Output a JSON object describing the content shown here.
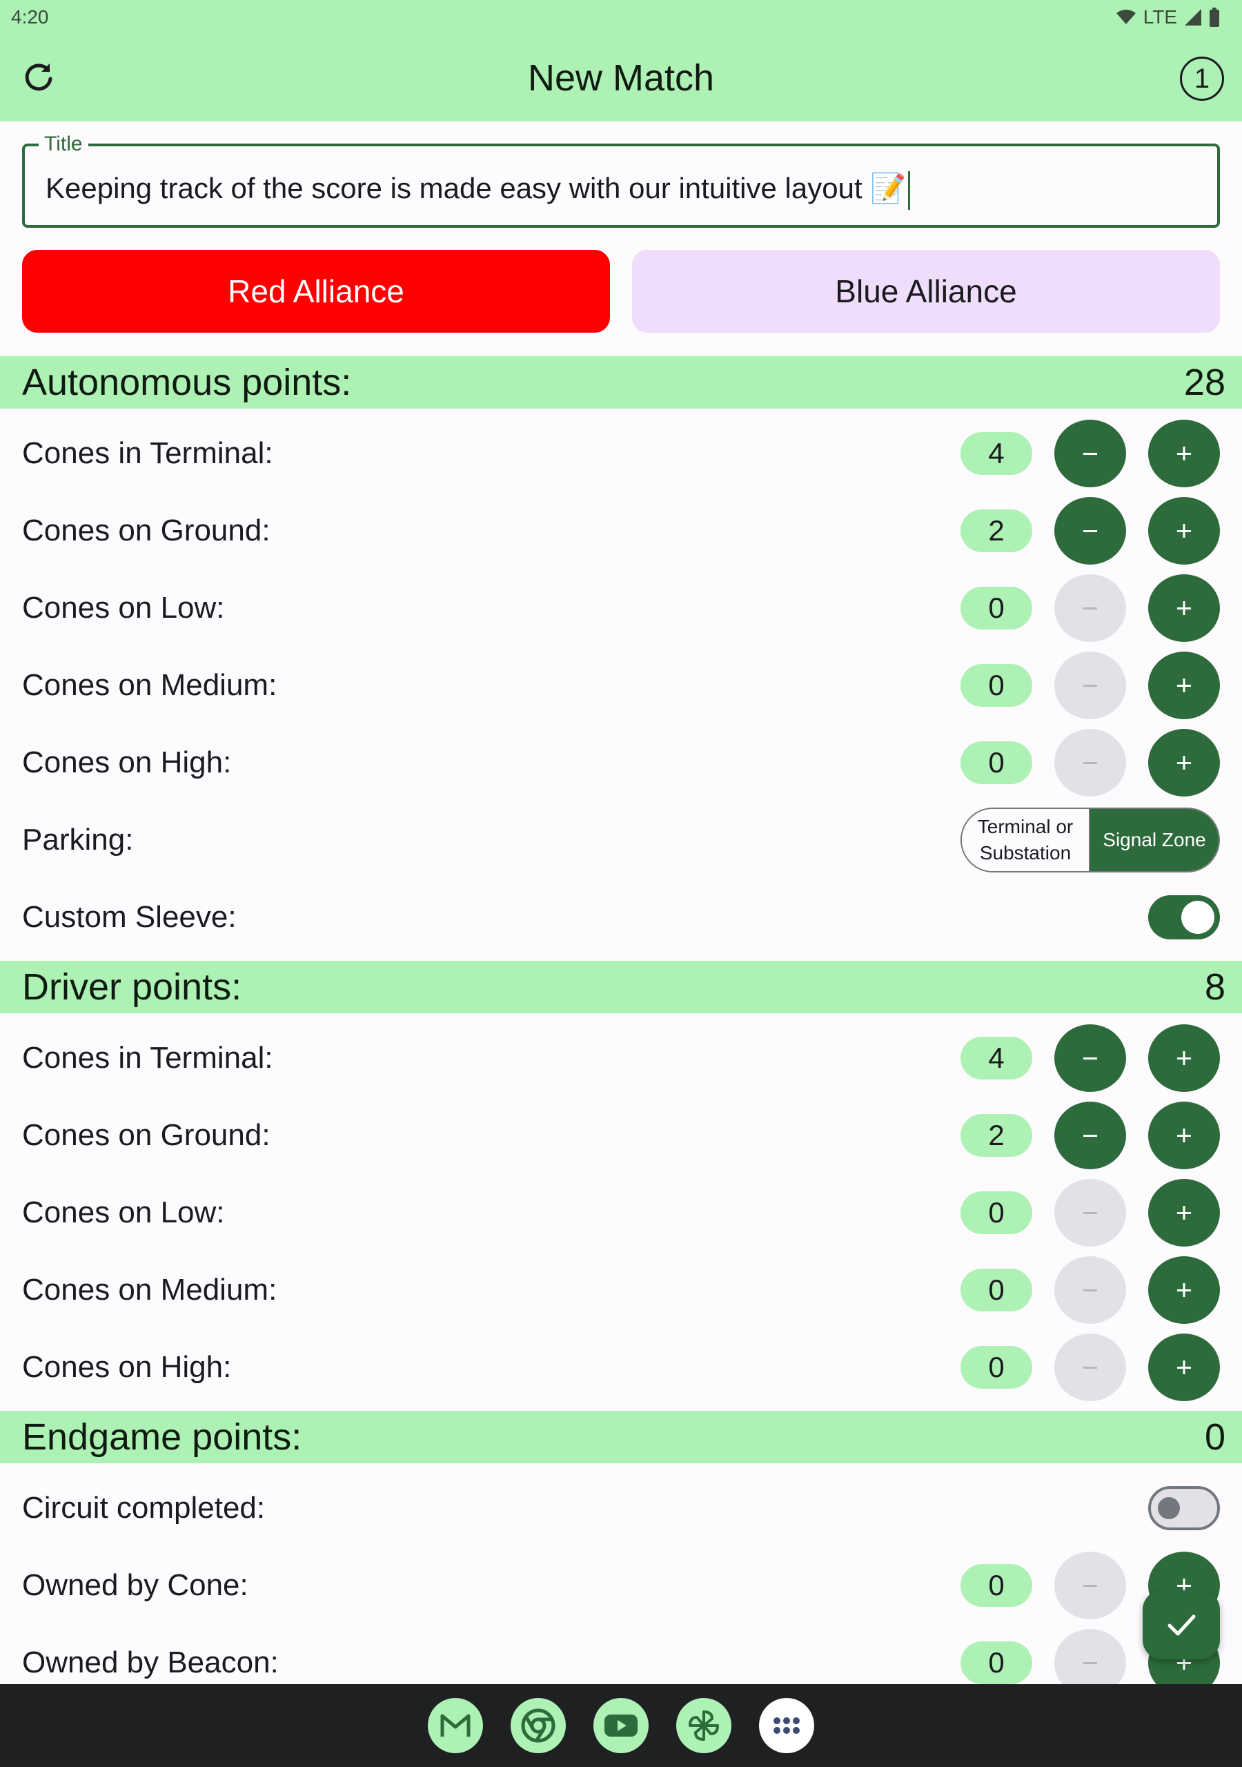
{
  "status_bar": {
    "time": "4:20",
    "network": "LTE"
  },
  "app_bar": {
    "title": "New Match",
    "match_count": "1"
  },
  "title_field": {
    "label": "Title",
    "value": "Keeping track of the score is made easy with our intuitive layout 📝"
  },
  "alliance": {
    "red_label": "Red Alliance",
    "blue_label": "Blue Alliance",
    "selected": "red"
  },
  "sections": {
    "autonomous": {
      "title": "Autonomous points:",
      "total": "28",
      "rows": [
        {
          "label": "Cones in Terminal:",
          "value": "4"
        },
        {
          "label": "Cones on Ground:",
          "value": "2"
        },
        {
          "label": "Cones on Low:",
          "value": "0"
        },
        {
          "label": "Cones on Medium:",
          "value": "0"
        },
        {
          "label": "Cones on High:",
          "value": "0"
        }
      ],
      "parking": {
        "label": "Parking:",
        "option_a": "Terminal or Substation",
        "option_b": "Signal Zone",
        "selected": "Signal Zone"
      },
      "custom_sleeve": {
        "label": "Custom Sleeve:",
        "on": true
      }
    },
    "driver": {
      "title": "Driver points:",
      "total": "8",
      "rows": [
        {
          "label": "Cones in Terminal:",
          "value": "4"
        },
        {
          "label": "Cones on Ground:",
          "value": "2"
        },
        {
          "label": "Cones on Low:",
          "value": "0"
        },
        {
          "label": "Cones on Medium:",
          "value": "0"
        },
        {
          "label": "Cones on High:",
          "value": "0"
        }
      ]
    },
    "endgame": {
      "title": "Endgame points:",
      "total": "0",
      "circuit": {
        "label": "Circuit completed:",
        "on": false
      },
      "rows": [
        {
          "label": "Owned by Cone:",
          "value": "0"
        },
        {
          "label": "Owned by Beacon:",
          "value": "0"
        }
      ]
    }
  },
  "colors": {
    "accent": "#2d6b3c",
    "header": "#aef1b4",
    "red": "#ff0000",
    "blue_tonal": "#f0dcfb"
  },
  "taskbar": {
    "apps": [
      "gmail-icon",
      "chrome-icon",
      "youtube-icon",
      "photos-icon",
      "app-drawer-icon"
    ]
  }
}
